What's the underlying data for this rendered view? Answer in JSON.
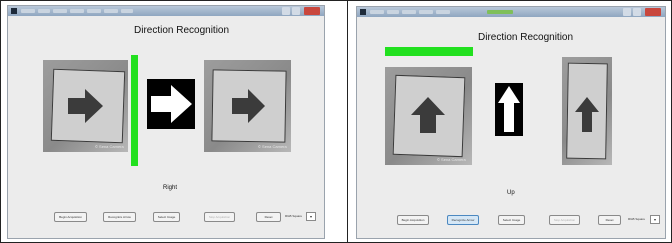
{
  "screens": [
    {
      "app_title": "Direction Recognition",
      "result": "Right",
      "buttons": [
        "Begin Acquisition",
        "Recognize Arrow",
        "Select Image",
        "Stop Acquisition",
        "Reset"
      ],
      "select_label": "RGB Square",
      "detected_direction": "right",
      "watermark": "© Sena Camera"
    },
    {
      "app_title": "Direction Recognition",
      "result": "Up",
      "buttons": [
        "Begin Acquisition",
        "Recognize Arrow",
        "Select Image",
        "Stop Acquisition",
        "Reset"
      ],
      "select_label": "RGB Square",
      "detected_direction": "up",
      "watermark": "© Sena Camera"
    }
  ],
  "colors": {
    "detection_bar": "#22e01f",
    "arrow_box": "#000000",
    "arrow_fill": "#ffffff"
  }
}
